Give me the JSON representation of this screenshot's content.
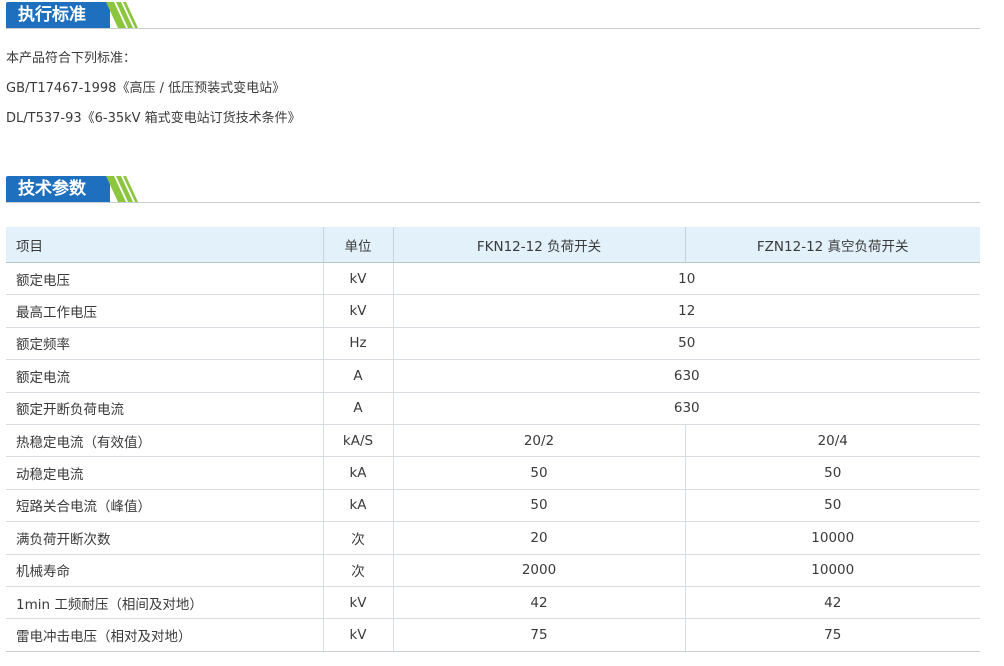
{
  "standards_section": {
    "title": "执行标准",
    "lines": [
      "本产品符合下列标准：",
      "GB/T17467-1998《高压 / 低压预装式变电站》",
      "DL/T537-93《6-35kV 箱式变电站订货技术条件》"
    ]
  },
  "params_section": {
    "title": "技术参数",
    "header": {
      "item": "项目",
      "unit": "单位",
      "col1": "FKN12-12 负荷开关",
      "col2": "FZN12-12 真空负荷开关"
    },
    "shared_rows": [
      {
        "item": "额定电压",
        "unit": "kV",
        "value": "10"
      },
      {
        "item": "最高工作电压",
        "unit": "kV",
        "value": "12"
      },
      {
        "item": "额定频率",
        "unit": "Hz",
        "value": "50"
      },
      {
        "item": "额定电流",
        "unit": "A",
        "value": "630"
      },
      {
        "item": "额定开断负荷电流",
        "unit": "A",
        "value": "630"
      }
    ],
    "split_rows": [
      {
        "item": "热稳定电流（有效值）",
        "unit": "kA/S",
        "v1": "20/2",
        "v2": "20/4"
      },
      {
        "item": "动稳定电流",
        "unit": "kA",
        "v1": "50",
        "v2": "50"
      },
      {
        "item": "短路关合电流（峰值）",
        "unit": "kA",
        "v1": "50",
        "v2": "50"
      },
      {
        "item": "满负荷开断次数",
        "unit": "次",
        "v1": "20",
        "v2": "10000"
      },
      {
        "item": "机械寿命",
        "unit": "次",
        "v1": "2000",
        "v2": "10000"
      },
      {
        "item": "1min 工频耐压（相间及对地）",
        "unit": "kV",
        "v1": "42",
        "v2": "42"
      },
      {
        "item": "雷电冲击电压（相对及对地）",
        "unit": "kV",
        "v1": "75",
        "v2": "75"
      }
    ]
  },
  "colors": {
    "accent": "#1f6fbf",
    "stripe": "#8cc63f",
    "header_bg": "#e3f1fb"
  }
}
